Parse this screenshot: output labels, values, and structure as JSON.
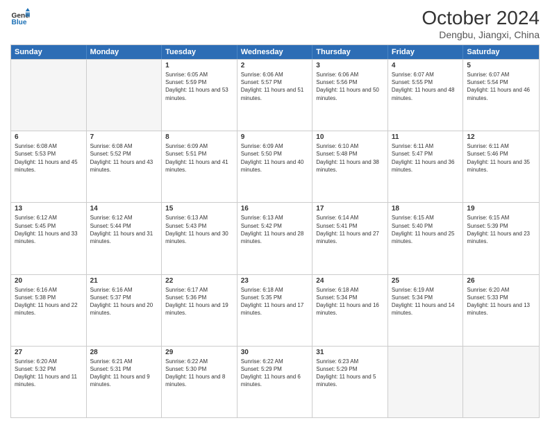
{
  "header": {
    "logo_line1": "General",
    "logo_line2": "Blue",
    "month_title": "October 2024",
    "location": "Dengbu, Jiangxi, China"
  },
  "day_headers": [
    "Sunday",
    "Monday",
    "Tuesday",
    "Wednesday",
    "Thursday",
    "Friday",
    "Saturday"
  ],
  "weeks": [
    [
      {
        "num": "",
        "empty": true
      },
      {
        "num": "",
        "empty": true
      },
      {
        "num": "1",
        "sunrise": "6:05 AM",
        "sunset": "5:59 PM",
        "daylight": "11 hours and 53 minutes."
      },
      {
        "num": "2",
        "sunrise": "6:06 AM",
        "sunset": "5:57 PM",
        "daylight": "11 hours and 51 minutes."
      },
      {
        "num": "3",
        "sunrise": "6:06 AM",
        "sunset": "5:56 PM",
        "daylight": "11 hours and 50 minutes."
      },
      {
        "num": "4",
        "sunrise": "6:07 AM",
        "sunset": "5:55 PM",
        "daylight": "11 hours and 48 minutes."
      },
      {
        "num": "5",
        "sunrise": "6:07 AM",
        "sunset": "5:54 PM",
        "daylight": "11 hours and 46 minutes."
      }
    ],
    [
      {
        "num": "6",
        "sunrise": "6:08 AM",
        "sunset": "5:53 PM",
        "daylight": "11 hours and 45 minutes."
      },
      {
        "num": "7",
        "sunrise": "6:08 AM",
        "sunset": "5:52 PM",
        "daylight": "11 hours and 43 minutes."
      },
      {
        "num": "8",
        "sunrise": "6:09 AM",
        "sunset": "5:51 PM",
        "daylight": "11 hours and 41 minutes."
      },
      {
        "num": "9",
        "sunrise": "6:09 AM",
        "sunset": "5:50 PM",
        "daylight": "11 hours and 40 minutes."
      },
      {
        "num": "10",
        "sunrise": "6:10 AM",
        "sunset": "5:48 PM",
        "daylight": "11 hours and 38 minutes."
      },
      {
        "num": "11",
        "sunrise": "6:11 AM",
        "sunset": "5:47 PM",
        "daylight": "11 hours and 36 minutes."
      },
      {
        "num": "12",
        "sunrise": "6:11 AM",
        "sunset": "5:46 PM",
        "daylight": "11 hours and 35 minutes."
      }
    ],
    [
      {
        "num": "13",
        "sunrise": "6:12 AM",
        "sunset": "5:45 PM",
        "daylight": "11 hours and 33 minutes."
      },
      {
        "num": "14",
        "sunrise": "6:12 AM",
        "sunset": "5:44 PM",
        "daylight": "11 hours and 31 minutes."
      },
      {
        "num": "15",
        "sunrise": "6:13 AM",
        "sunset": "5:43 PM",
        "daylight": "11 hours and 30 minutes."
      },
      {
        "num": "16",
        "sunrise": "6:13 AM",
        "sunset": "5:42 PM",
        "daylight": "11 hours and 28 minutes."
      },
      {
        "num": "17",
        "sunrise": "6:14 AM",
        "sunset": "5:41 PM",
        "daylight": "11 hours and 27 minutes."
      },
      {
        "num": "18",
        "sunrise": "6:15 AM",
        "sunset": "5:40 PM",
        "daylight": "11 hours and 25 minutes."
      },
      {
        "num": "19",
        "sunrise": "6:15 AM",
        "sunset": "5:39 PM",
        "daylight": "11 hours and 23 minutes."
      }
    ],
    [
      {
        "num": "20",
        "sunrise": "6:16 AM",
        "sunset": "5:38 PM",
        "daylight": "11 hours and 22 minutes."
      },
      {
        "num": "21",
        "sunrise": "6:16 AM",
        "sunset": "5:37 PM",
        "daylight": "11 hours and 20 minutes."
      },
      {
        "num": "22",
        "sunrise": "6:17 AM",
        "sunset": "5:36 PM",
        "daylight": "11 hours and 19 minutes."
      },
      {
        "num": "23",
        "sunrise": "6:18 AM",
        "sunset": "5:35 PM",
        "daylight": "11 hours and 17 minutes."
      },
      {
        "num": "24",
        "sunrise": "6:18 AM",
        "sunset": "5:34 PM",
        "daylight": "11 hours and 16 minutes."
      },
      {
        "num": "25",
        "sunrise": "6:19 AM",
        "sunset": "5:34 PM",
        "daylight": "11 hours and 14 minutes."
      },
      {
        "num": "26",
        "sunrise": "6:20 AM",
        "sunset": "5:33 PM",
        "daylight": "11 hours and 13 minutes."
      }
    ],
    [
      {
        "num": "27",
        "sunrise": "6:20 AM",
        "sunset": "5:32 PM",
        "daylight": "11 hours and 11 minutes."
      },
      {
        "num": "28",
        "sunrise": "6:21 AM",
        "sunset": "5:31 PM",
        "daylight": "11 hours and 9 minutes."
      },
      {
        "num": "29",
        "sunrise": "6:22 AM",
        "sunset": "5:30 PM",
        "daylight": "11 hours and 8 minutes."
      },
      {
        "num": "30",
        "sunrise": "6:22 AM",
        "sunset": "5:29 PM",
        "daylight": "11 hours and 6 minutes."
      },
      {
        "num": "31",
        "sunrise": "6:23 AM",
        "sunset": "5:29 PM",
        "daylight": "11 hours and 5 minutes."
      },
      {
        "num": "",
        "empty": true
      },
      {
        "num": "",
        "empty": true
      }
    ]
  ]
}
